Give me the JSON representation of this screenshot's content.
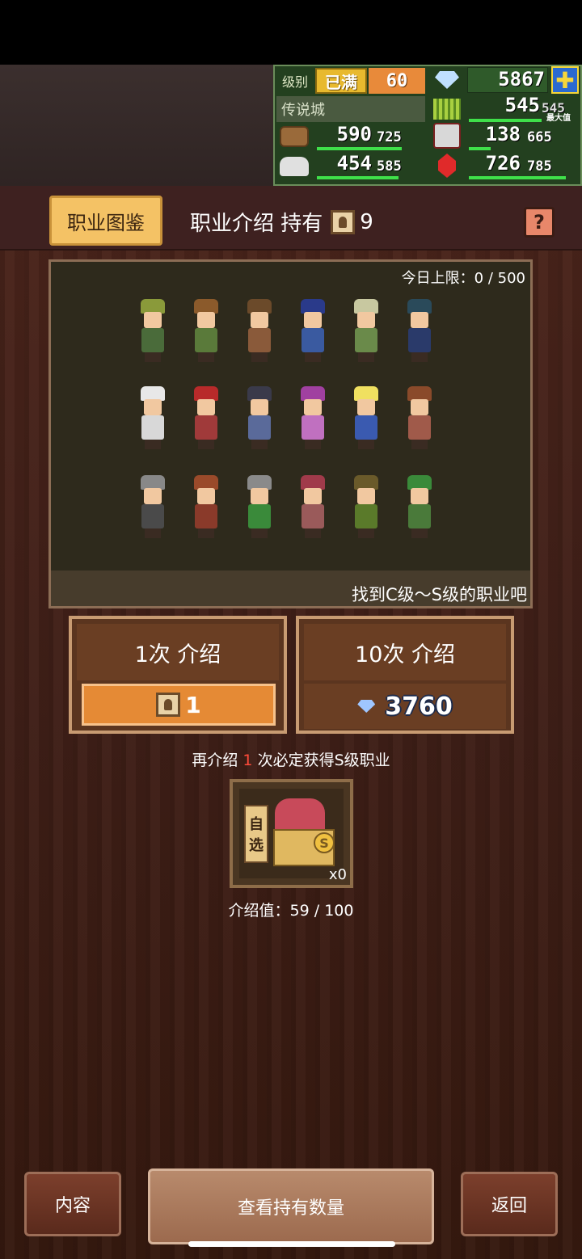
{
  "status": {
    "level_label": "级别",
    "level_status": "已满",
    "level_value": "60",
    "diamonds": "5867",
    "town_name": "传说城",
    "food": "545",
    "food_max": "545",
    "food_tag": "最大值",
    "wood": "590",
    "wood_max": "725",
    "ore": "138",
    "ore_max": "665",
    "stone": "454",
    "stone_max": "585",
    "ruby": "726",
    "ruby_max": "785",
    "progress": {
      "food": 1.0,
      "wood": 0.81,
      "ore": 0.21,
      "stone": 0.78,
      "ruby": 0.92
    }
  },
  "tabs": {
    "active_tab": "职业图鉴",
    "title": "职业介绍 持有",
    "ticket_count": "9",
    "help": "?"
  },
  "panel": {
    "daily_limit": "今日上限：0 / 500",
    "hint": "找到C级～S级的职业吧",
    "characters": [
      {
        "hat": "#8a9a3a",
        "body": "#4a6b3a"
      },
      {
        "hat": "#8b5a2b",
        "body": "#5a7a3a"
      },
      {
        "hat": "#6b4a2a",
        "body": "#8a5a3a"
      },
      {
        "hat": "#2a3a8a",
        "body": "#3a5aa0"
      },
      {
        "hat": "#c8c8a0",
        "body": "#6a8a4a"
      },
      {
        "hat": "#2a4a5a",
        "body": "#2a3a6a"
      },
      {
        "hat": "#e8e8e8",
        "body": "#d8d8d8"
      },
      {
        "hat": "#b82a2a",
        "body": "#a03a3a"
      },
      {
        "hat": "#3a3a4a",
        "body": "#5a6a9a"
      },
      {
        "hat": "#a040a0",
        "body": "#c070c0"
      },
      {
        "hat": "#f0e060",
        "body": "#3a5ab0"
      },
      {
        "hat": "#8a4a2a",
        "body": "#a05a4a"
      },
      {
        "hat": "#888888",
        "body": "#4a4a4a"
      },
      {
        "hat": "#9a4a2a",
        "body": "#8a3a2a"
      },
      {
        "hat": "#8a8a8a",
        "body": "#3a8a3a"
      },
      {
        "hat": "#a03a4a",
        "body": "#9a5a5a"
      },
      {
        "hat": "#6a5a2a",
        "body": "#5a7a2a"
      },
      {
        "hat": "#3a8a3a",
        "body": "#4a7a3a"
      }
    ]
  },
  "summon": {
    "single_label": "1次 介绍",
    "single_cost": "1",
    "ten_label": "10次 介绍",
    "ten_cost": "3760"
  },
  "notice": {
    "prefix": "再介绍",
    "count": "1",
    "suffix": "次必定获得S级职业"
  },
  "reward": {
    "badge_line1": "自",
    "badge_line2": "选",
    "grade": "S",
    "count": "x0",
    "progress_text": "介绍值：59 / 100",
    "progress": 0.59
  },
  "bottom": {
    "left": "内容",
    "center": "查看持有数量",
    "right": "返回"
  },
  "colors": {
    "accent": "#f4c265",
    "orange": "#e58a35",
    "red_text": "#ff4b3a",
    "bar_green": "#3fe04a"
  }
}
